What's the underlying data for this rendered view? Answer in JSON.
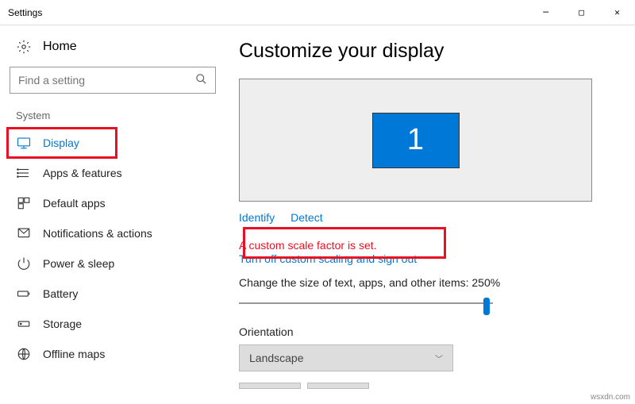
{
  "window": {
    "title": "Settings"
  },
  "sidebar": {
    "home": "Home",
    "search_placeholder": "Find a setting",
    "section": "System",
    "items": [
      {
        "label": "Display",
        "icon": "display"
      },
      {
        "label": "Apps & features",
        "icon": "apps"
      },
      {
        "label": "Default apps",
        "icon": "default-apps"
      },
      {
        "label": "Notifications & actions",
        "icon": "notifications"
      },
      {
        "label": "Power & sleep",
        "icon": "power"
      },
      {
        "label": "Battery",
        "icon": "battery"
      },
      {
        "label": "Storage",
        "icon": "storage"
      },
      {
        "label": "Offline maps",
        "icon": "maps"
      }
    ]
  },
  "main": {
    "heading": "Customize your display",
    "monitor_number": "1",
    "identify": "Identify",
    "detect": "Detect",
    "scale_warning": "A custom scale factor is set.",
    "scale_action": "Turn off custom scaling and sign out",
    "scale_label": "Change the size of text, apps, and other items: 250%",
    "orientation_label": "Orientation",
    "orientation_value": "Landscape"
  },
  "watermark": "wsxdn.com"
}
